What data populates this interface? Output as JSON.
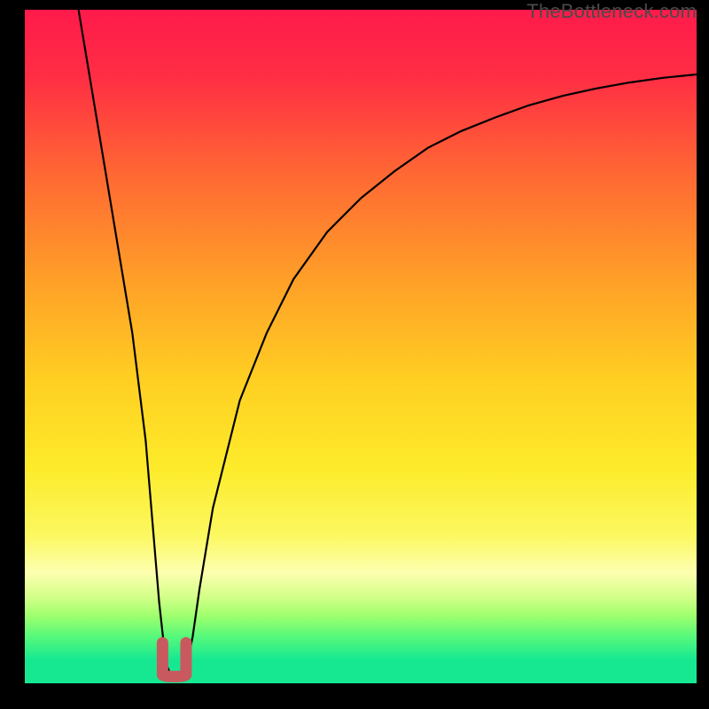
{
  "watermark": "TheBottleneck.com",
  "chart_data": {
    "type": "line",
    "title": "",
    "xlabel": "",
    "ylabel": "",
    "xlim": [
      0,
      100
    ],
    "ylim": [
      0,
      100
    ],
    "gradient_stops": [
      {
        "offset": 0.0,
        "color": "#ff1a4b"
      },
      {
        "offset": 0.1,
        "color": "#ff2e44"
      },
      {
        "offset": 0.25,
        "color": "#ff6a33"
      },
      {
        "offset": 0.4,
        "color": "#ff9f28"
      },
      {
        "offset": 0.55,
        "color": "#ffcf22"
      },
      {
        "offset": 0.68,
        "color": "#fdeb2a"
      },
      {
        "offset": 0.78,
        "color": "#fbf860"
      },
      {
        "offset": 0.835,
        "color": "#fdffb0"
      },
      {
        "offset": 0.87,
        "color": "#d6ff8a"
      },
      {
        "offset": 0.9,
        "color": "#9eff6e"
      },
      {
        "offset": 0.93,
        "color": "#58f97a"
      },
      {
        "offset": 0.965,
        "color": "#16e892"
      },
      {
        "offset": 1.0,
        "color": "#16e892"
      }
    ],
    "series": [
      {
        "name": "bottleneck-curve",
        "x": [
          8,
          10,
          12,
          14,
          16,
          18,
          19,
          20,
          21,
          22,
          23,
          24,
          25,
          26,
          28,
          32,
          36,
          40,
          45,
          50,
          55,
          60,
          65,
          70,
          75,
          80,
          85,
          90,
          95,
          100
        ],
        "values": [
          100,
          88,
          76,
          64,
          52,
          36,
          24,
          12,
          3,
          0.5,
          0.5,
          2,
          7,
          14,
          26,
          42,
          52,
          60,
          67,
          72,
          76,
          79.5,
          82,
          84,
          85.8,
          87.2,
          88.3,
          89.2,
          89.9,
          90.4
        ]
      }
    ],
    "marker": {
      "x_range": [
        20.5,
        24
      ],
      "y": 2.5,
      "color": "#c85a5f"
    }
  }
}
